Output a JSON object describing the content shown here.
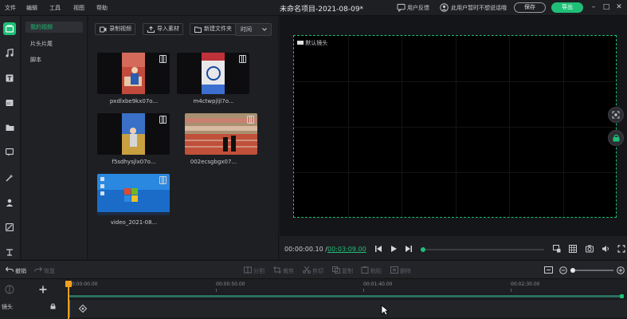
{
  "menu": [
    "文件",
    "编辑",
    "工具",
    "视图",
    "帮助"
  ],
  "project_title": "未命名项目-2021-08-09*",
  "titlebar": {
    "feedback": "用户反馈",
    "login_notice": "此用户暂时不想说话哦",
    "save": "保存",
    "export": "导出"
  },
  "rail_icons": [
    "media-icon",
    "music-icon",
    "text-icon",
    "subtitle-icon",
    "folder-icon",
    "comment-icon",
    "effects-icon",
    "person-icon",
    "filter-icon",
    "transition-icon"
  ],
  "categories": [
    "我的视频",
    "片头片尾",
    "脚本"
  ],
  "media_toolbar": {
    "record": "录制视频",
    "import": "导入素材",
    "new_folder": "新建文件夹",
    "sort": "时间"
  },
  "media": [
    {
      "caption": "pxdlxbe9kx07o..."
    },
    {
      "caption": "m4ctwpjljl7o..."
    },
    {
      "caption": "f5sdhysjlx07o..."
    },
    {
      "caption": "002ecsgbgx07..."
    },
    {
      "caption": "video_2021-08..."
    }
  ],
  "preview": {
    "label": "默认镜头",
    "time_current": "00:00:00.10 /",
    "time_total": "00:03:09.00",
    "progress": 0.02
  },
  "timeline_tools": {
    "undo": "撤销",
    "redo": "恢复",
    "split": "分割",
    "crop": "裁剪",
    "cut": "剪切",
    "copy": "复制",
    "paste": "粘贴",
    "delete": "删除"
  },
  "ruler": [
    "00:00:00.00",
    "00:00:50.00",
    "00:01:40.00",
    "00:02:30.00"
  ],
  "track": {
    "label": "镜头"
  }
}
